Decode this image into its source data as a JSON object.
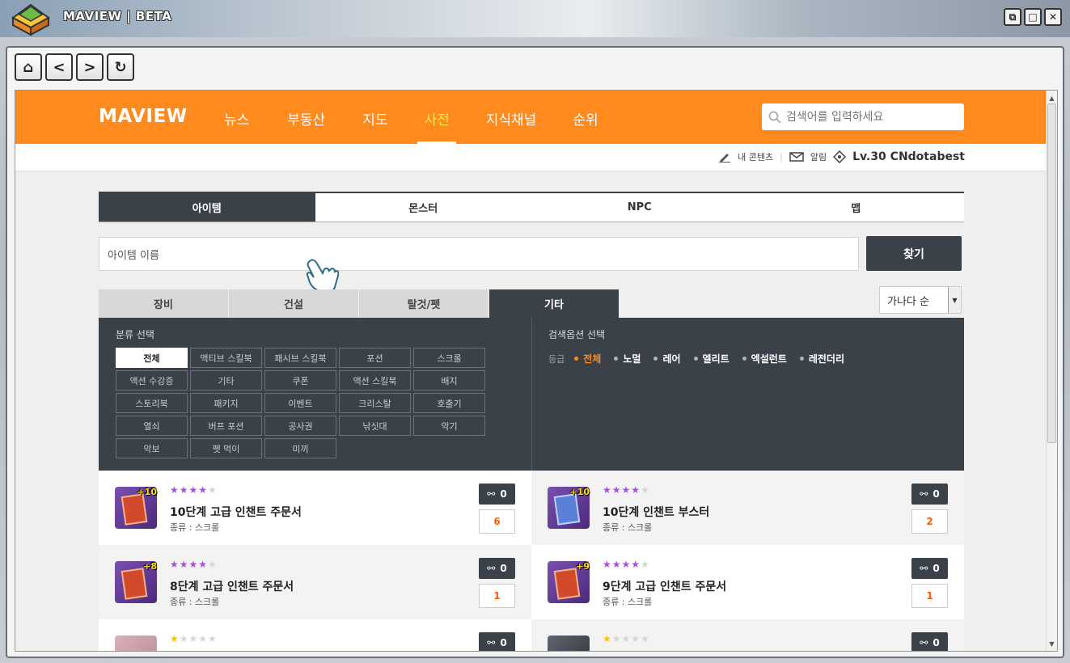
{
  "app": {
    "title": "MAVIEW | BETA"
  },
  "window_controls": {
    "restore": "⧉",
    "maximize": "□",
    "close": "✕"
  },
  "browser_nav": {
    "home": "⌂",
    "back": "<",
    "forward": ">",
    "refresh": "↻"
  },
  "header": {
    "brand": "MAVIEW",
    "nav": [
      "뉴스",
      "부동산",
      "지도",
      "사전",
      "지식채널",
      "순위"
    ],
    "active_nav": "사전",
    "search_placeholder": "검색어를 입력하세요"
  },
  "userbar": {
    "my_content": "내 콘텐츠",
    "notifications": "알림",
    "level_user": "Lv.30 CNdotabest"
  },
  "main_tabs": [
    "아이템",
    "몬스터",
    "NPC",
    "맵"
  ],
  "search_box": {
    "value": "아이템 이름",
    "button": "찾기"
  },
  "sub_tabs": [
    "장비",
    "건설",
    "탈것/펫",
    "기타"
  ],
  "sort": {
    "selected": "가나다 순"
  },
  "filter": {
    "category_title": "분류 선택",
    "categories": [
      "전체",
      "액티브 스킬북",
      "패시브 스킬북",
      "포션",
      "스크롤",
      "액션 수강증",
      "기타",
      "쿠폰",
      "액션 스킬북",
      "배지",
      "스토리북",
      "패키지",
      "이벤트",
      "크리스탈",
      "호출기",
      "열쇠",
      "버프 포션",
      "공사권",
      "낚싯대",
      "악기",
      "악보",
      "펫 먹이",
      "미끼"
    ],
    "option_title": "검색옵션 선택",
    "grade_label": "등급",
    "grades": [
      "전체",
      "노멀",
      "레어",
      "엘리트",
      "엑설런트",
      "레전더리"
    ]
  },
  "items": [
    {
      "name": "10단계 고급 인챈트 주문서",
      "type": "종류 : 스크롤",
      "stars": 4,
      "links": "0",
      "count": "6",
      "badge": "+10"
    },
    {
      "name": "10단계 인챈트 부스터",
      "type": "종류 : 스크롤",
      "stars": 4,
      "links": "0",
      "count": "2",
      "badge": "+10"
    },
    {
      "name": "8단계 고급 인챈트 주문서",
      "type": "종류 : 스크롤",
      "stars": 4,
      "links": "0",
      "count": "1",
      "badge": "+8"
    },
    {
      "name": "9단계 고급 인챈트 주문서",
      "type": "종류 : 스크롤",
      "stars": 4,
      "links": "0",
      "count": "1",
      "badge": "+9"
    },
    {
      "name": "",
      "type": "",
      "stars": 1,
      "links": "0",
      "count": "",
      "badge": ""
    },
    {
      "name": "",
      "type": "",
      "stars": 1,
      "links": "0",
      "count": "",
      "badge": ""
    }
  ],
  "colors": {
    "header_orange": "#ff8a1e",
    "dark": "#3a4149",
    "active_nav": "#ffe94c",
    "count": "#ff5a00",
    "star_purple": "#a94de0",
    "star_gold": "#f6c600"
  }
}
